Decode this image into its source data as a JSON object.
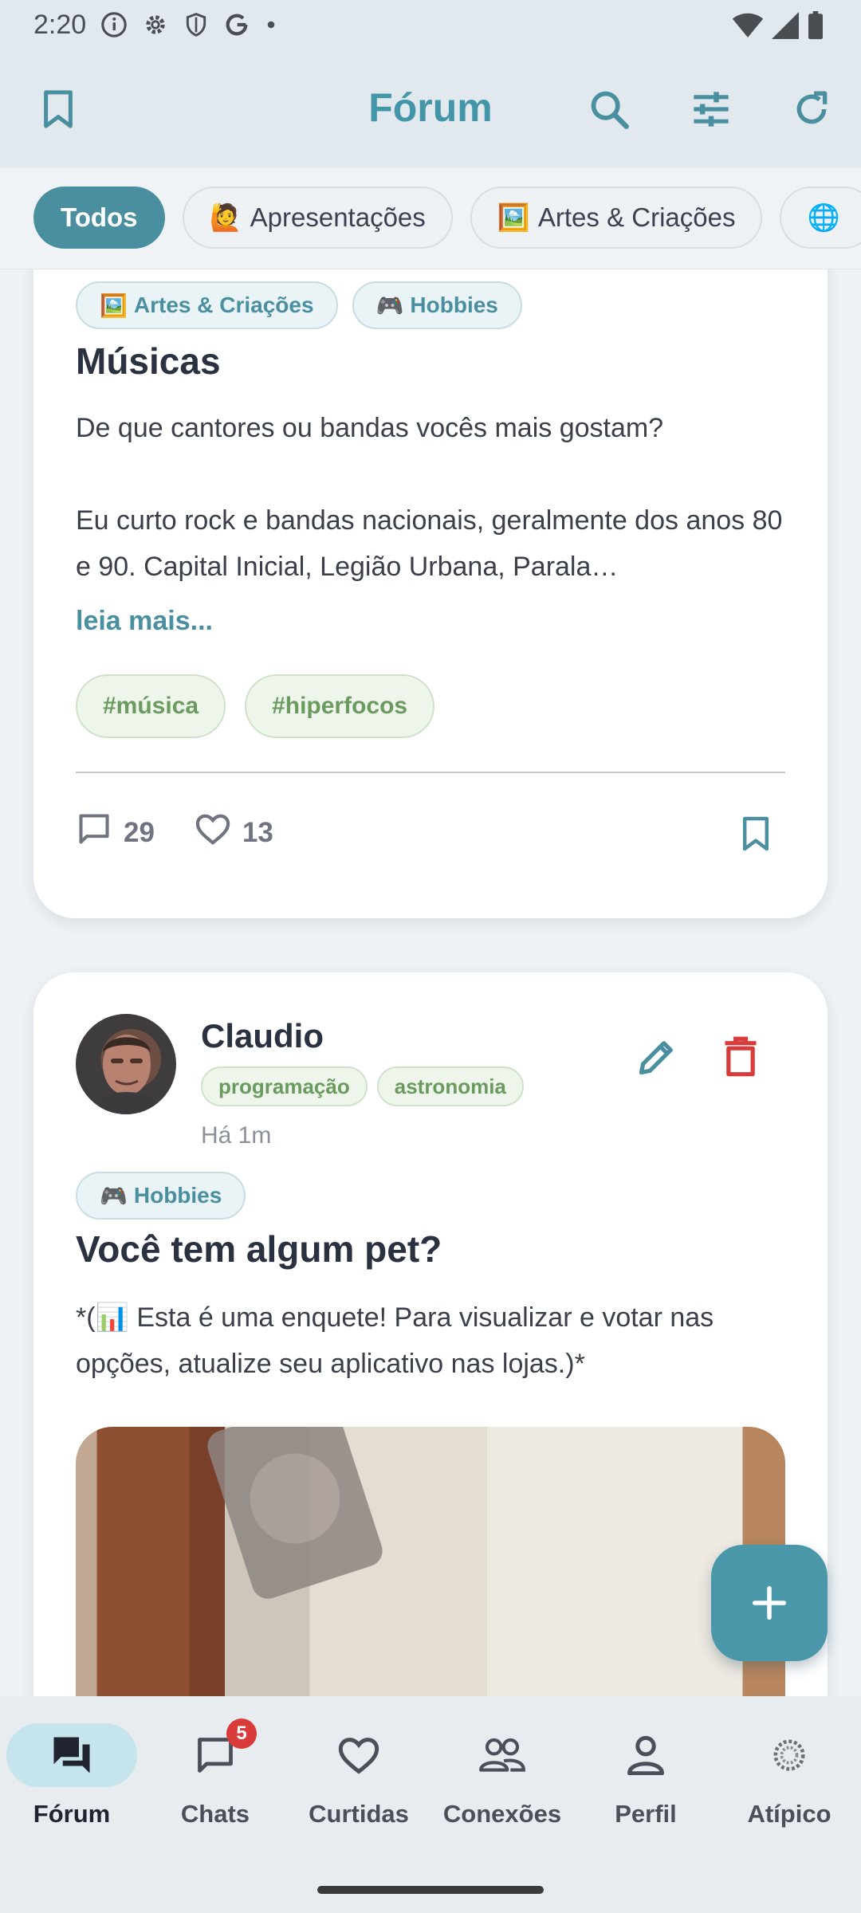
{
  "status_bar": {
    "time": "2:20"
  },
  "app_bar": {
    "title": "Fórum"
  },
  "filters": [
    {
      "label": "Todos",
      "emoji": ""
    },
    {
      "label": "Apresentações",
      "emoji": "🙋"
    },
    {
      "label": "Artes & Criações",
      "emoji": "🖼️"
    },
    {
      "label": "",
      "emoji": "🌐"
    }
  ],
  "post1": {
    "categories": [
      {
        "emoji": "🖼️",
        "label": "Artes & Criações"
      },
      {
        "emoji": "🎮",
        "label": "Hobbies"
      }
    ],
    "title": "Músicas",
    "body_line1": "De que cantores ou bandas vocês mais gostam?",
    "body_para2": "Eu curto rock e bandas nacionais, geralmente dos anos 80 e 90. Capital Inicial, Legião Urbana, Parala…",
    "read_more": "leia mais...",
    "hashtags": [
      "#música",
      "#hiperfocos"
    ],
    "comments": "29",
    "likes": "13"
  },
  "post2": {
    "author": "Claudio",
    "interests": [
      "programação",
      "astronomia"
    ],
    "time_ago": "Há 1m",
    "category": {
      "emoji": "🎮",
      "label": "Hobbies"
    },
    "title": "Você tem algum pet?",
    "body": "*(📊 Esta é uma enquete! Para visualizar e votar nas opções, atualize seu aplicativo nas lojas.)*"
  },
  "bottom_nav": {
    "items": [
      {
        "label": "Fórum",
        "icon": "forum-icon"
      },
      {
        "label": "Chats",
        "icon": "chat-icon",
        "badge": "5"
      },
      {
        "label": "Curtidas",
        "icon": "heart-icon"
      },
      {
        "label": "Conexões",
        "icon": "people-icon"
      },
      {
        "label": "Perfil",
        "icon": "person-icon"
      },
      {
        "label": "Atípico",
        "icon": "atipico-logo-icon"
      }
    ]
  },
  "colors": {
    "accent": "#4a8fa0",
    "title": "#4396a8",
    "danger": "#d93a3a",
    "tag_green": "#6a9a5e"
  }
}
